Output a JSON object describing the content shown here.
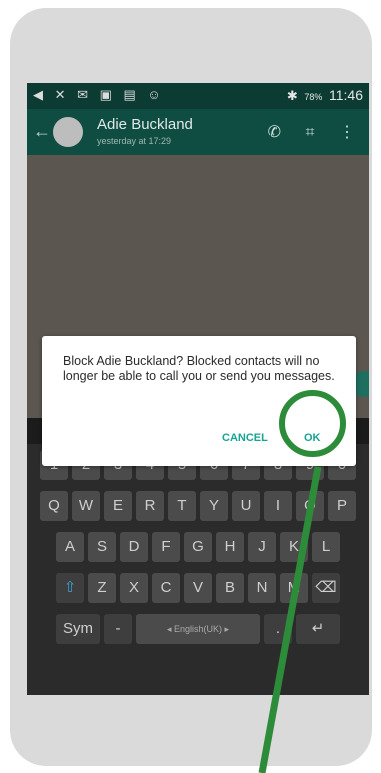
{
  "statusbar": {
    "left_icons": "◀ ✕ ✉ ▣ ▤ ☺",
    "bluetooth": "✱",
    "signal": "📶",
    "battery_pct": "78%",
    "time": "11:46"
  },
  "appbar": {
    "back": "←",
    "contact_name": "Adie Buckland",
    "contact_status": "yesterday at 17:29",
    "call_icon": "✆",
    "attach_icon": "⌗",
    "menu_icon": "⋮"
  },
  "dialog": {
    "message": "Block Adie Buckland? Blocked contacts will no longer be able to call you or send you messages.",
    "cancel_label": "CANCEL",
    "ok_label": "OK"
  },
  "keyboard": {
    "row1": [
      "1",
      "2",
      "3",
      "4",
      "5",
      "6",
      "7",
      "8",
      "9",
      "0"
    ],
    "row2": [
      "Q",
      "W",
      "E",
      "R",
      "T",
      "Y",
      "U",
      "I",
      "O",
      "P"
    ],
    "row3": [
      "A",
      "S",
      "D",
      "F",
      "G",
      "H",
      "J",
      "K",
      "L"
    ],
    "row4": [
      "Z",
      "X",
      "C",
      "V",
      "B",
      "N",
      "M"
    ],
    "sym_label": "Sym",
    "space_label": "◂ English(UK) ▸",
    "enter_icon": "↵",
    "backspace_icon": "⌫",
    "shift_icon": "⇧"
  },
  "colors": {
    "header_green": "#0f4d43",
    "accent_teal": "#17a495",
    "highlight_green": "#2d8c3a"
  }
}
